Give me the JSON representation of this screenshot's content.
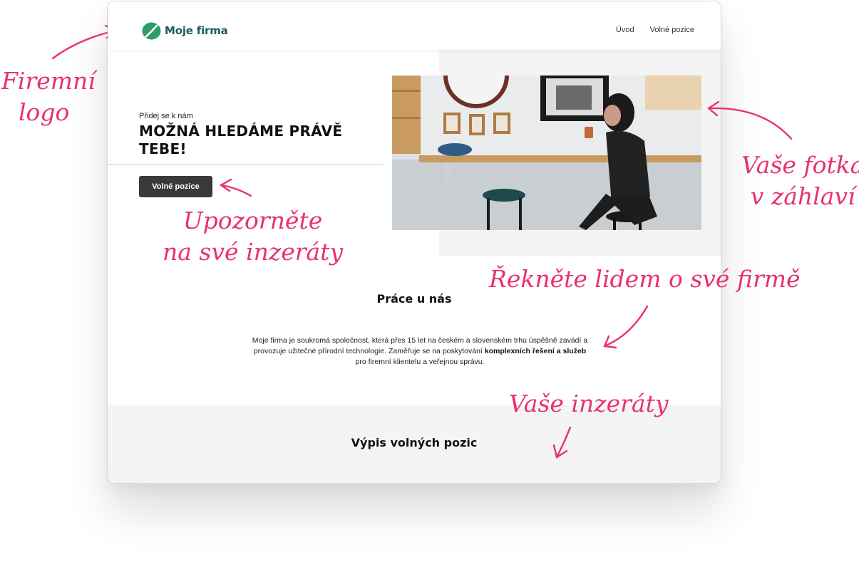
{
  "header": {
    "brand": "Moje firma",
    "logo": "leaf-logo-icon",
    "brand_color": "#1f5a5c",
    "nav": [
      "Úvod",
      "Volné pozice"
    ]
  },
  "hero": {
    "eyebrow": "Přidej se k nám",
    "headline": "MOŽNÁ HLEDÁME PRÁVĚ TEBE!",
    "cta": "Volné pozice",
    "photo": "woman-in-cafe-photo"
  },
  "about": {
    "title": "Práce u nás",
    "text_part1": "Moje firma je soukromá společnost, která přes 15 let na českém a slovenském trhu úspěšně zavádí a provozuje užitečné přírodní technologie. Zaměřuje se na poskytování ",
    "text_bold": "komplexních řešení a služeb",
    "text_part2": " pro firemní klientelu a veřejnou správu."
  },
  "jobs": {
    "title": "Výpis volných pozic"
  },
  "annotations": {
    "logo": [
      "Firemní",
      "logo"
    ],
    "photo": [
      "Vaše fotka",
      "v záhlaví"
    ],
    "cta": [
      "Upozorněte",
      "na své inzeráty"
    ],
    "about": "Řekněte lidem o své firmě",
    "jobs": "Vaše inzeráty",
    "color": "#e8326c"
  }
}
